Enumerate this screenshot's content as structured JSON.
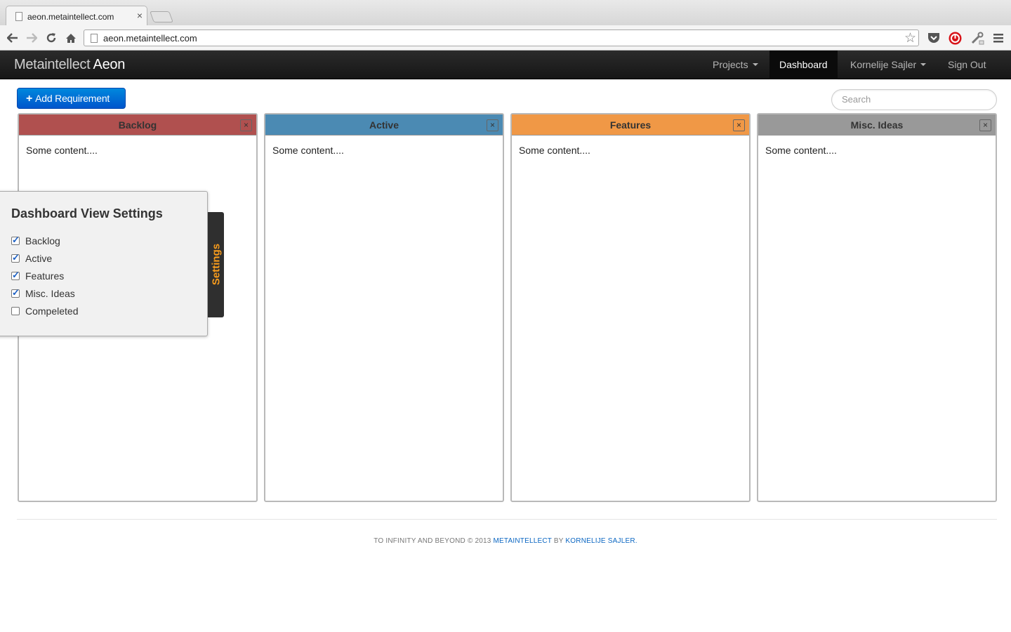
{
  "browser": {
    "tab_title": "aeon.metaintellect.com",
    "tab_close": "×",
    "url": "aeon.metaintellect.com"
  },
  "app": {
    "brand_light": "Metaintellect",
    "brand_bold": "Aeon",
    "nav": {
      "projects": "Projects",
      "dashboard": "Dashboard",
      "user": "Kornelije Sajler",
      "signout": "Sign Out"
    }
  },
  "toolbar": {
    "add_button": "Add Requirement",
    "add_icon": "+",
    "search_placeholder": "Search"
  },
  "columns": [
    {
      "title": "Backlog",
      "content": "Some content....",
      "color": "#b0504f"
    },
    {
      "title": "Active",
      "content": "Some content....",
      "color": "#4b8ab3"
    },
    {
      "title": "Features",
      "content": "Some content....",
      "color": "#f09846"
    },
    {
      "title": "Misc. Ideas",
      "content": "Some content....",
      "color": "#999999"
    }
  ],
  "settings": {
    "title": "Dashboard View Settings",
    "tab_label": "Settings",
    "options": [
      {
        "label": "Backlog",
        "checked": true
      },
      {
        "label": "Active",
        "checked": true
      },
      {
        "label": "Features",
        "checked": true
      },
      {
        "label": "Misc. Ideas",
        "checked": true
      },
      {
        "label": "Compeleted",
        "checked": false
      }
    ]
  },
  "footer": {
    "prefix": "TO INFINITY AND BEYOND © 2013",
    "link1": "METAINTELLECT",
    "by": "BY",
    "link2": "KORNELIJE SAJLER",
    "suffix": "."
  }
}
